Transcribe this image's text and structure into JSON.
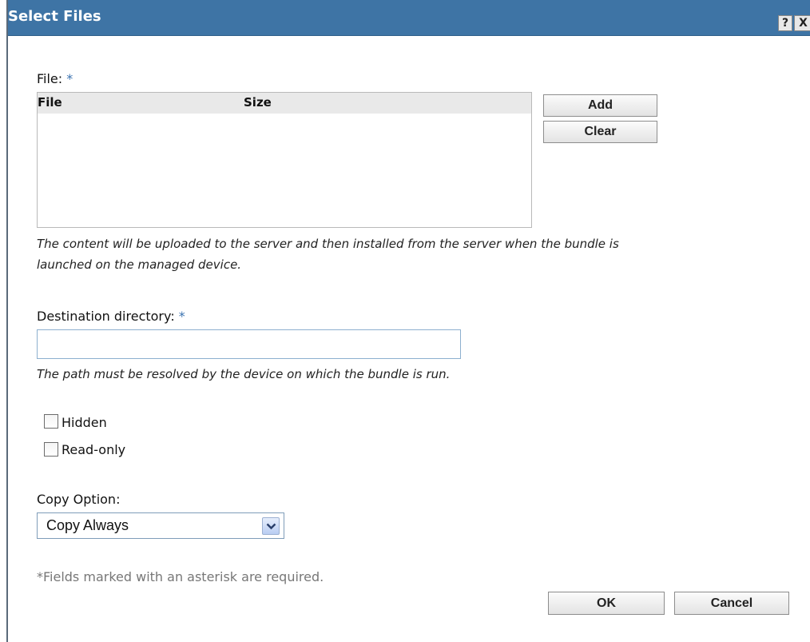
{
  "dialog": {
    "title": "Select Files",
    "help_label": "?",
    "close_label": "X"
  },
  "file_section": {
    "label": "File:",
    "required_mark": "*",
    "columns": [
      "File",
      "Size"
    ],
    "rows": [],
    "add_label": "Add",
    "clear_label": "Clear",
    "hint_line1": "The content will be uploaded to the server and then installed from the server when the bundle is",
    "hint_line2": "launched on the managed device."
  },
  "destination": {
    "label": "Destination directory:",
    "required_mark": "*",
    "value": "",
    "hint": "The path must be resolved by the device on which the bundle is run."
  },
  "options": {
    "hidden": {
      "label": "Hidden",
      "checked": false
    },
    "read_only": {
      "label": "Read-only",
      "checked": false
    }
  },
  "copy_option": {
    "label": "Copy Option:",
    "selected": "Copy Always"
  },
  "footer": {
    "note": "*Fields marked with an asterisk are required.",
    "ok_label": "OK",
    "cancel_label": "Cancel"
  },
  "colors": {
    "titlebar": "#3e74a5",
    "required_asterisk": "#3a72b0"
  }
}
